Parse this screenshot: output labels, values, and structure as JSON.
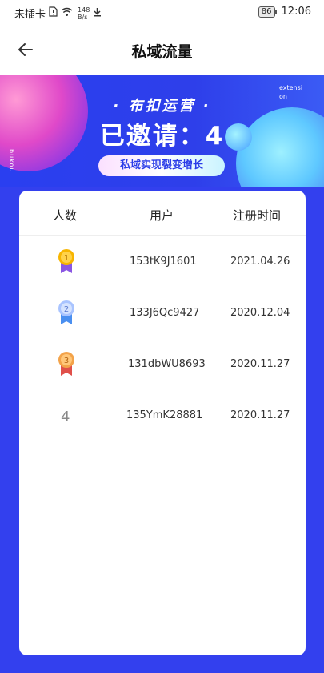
{
  "status_bar": {
    "carrier": "未插卡",
    "speed_value": "148",
    "speed_unit": "B/s",
    "battery": "86",
    "time": "12:06",
    "icons": [
      "sim-alert-icon",
      "wifi-icon",
      "download-icon"
    ]
  },
  "nav": {
    "title": "私域流量",
    "back_icon": "arrow-left-icon"
  },
  "banner": {
    "brand": "· 布扣运营 ·",
    "invite_text": "已邀请：4",
    "slogan": "私域实现裂变增长",
    "side_left": "bukou",
    "side_right": "extension"
  },
  "table": {
    "headers": [
      "人数",
      "用户",
      "注册时间"
    ],
    "rows": [
      {
        "rank": "1",
        "user": "153tK9J1601",
        "date": "2021.04.26",
        "medal": "gold"
      },
      {
        "rank": "2",
        "user": "133J6Qc9427",
        "date": "2020.12.04",
        "medal": "silver"
      },
      {
        "rank": "3",
        "user": "131dbWU8693",
        "date": "2020.11.27",
        "medal": "bronze"
      },
      {
        "rank": "4",
        "user": "135YmK28881",
        "date": "2020.11.27",
        "medal": ""
      }
    ]
  },
  "colors": {
    "accent_blue": "#3340ee",
    "gold": "#f7b500",
    "silver": "#8fb4ff",
    "bronze": "#f3a34a"
  }
}
